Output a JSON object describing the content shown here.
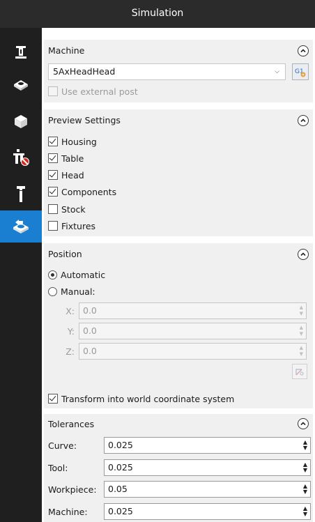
{
  "window": {
    "title": "Simulation"
  },
  "sidebar": {
    "items": [
      {
        "icon": "machine-column-icon",
        "active": false
      },
      {
        "icon": "stock-box-icon",
        "active": false
      },
      {
        "icon": "cube-icon",
        "active": false
      },
      {
        "icon": "fixture-disabled-icon",
        "active": false
      },
      {
        "icon": "tool-holder-icon",
        "active": false
      },
      {
        "icon": "simulation-table-icon",
        "active": true
      }
    ]
  },
  "machine": {
    "title": "Machine",
    "selected": "5AxHeadHead",
    "post_button": "G1",
    "use_external_post": "Use external post"
  },
  "preview": {
    "title": "Preview Settings",
    "items": [
      {
        "label": "Housing",
        "checked": true
      },
      {
        "label": "Table",
        "checked": true
      },
      {
        "label": "Head",
        "checked": true
      },
      {
        "label": "Components",
        "checked": true
      },
      {
        "label": "Stock",
        "checked": false
      },
      {
        "label": "Fixtures",
        "checked": false
      }
    ]
  },
  "position": {
    "title": "Position",
    "automatic": "Automatic",
    "manual": "Manual:",
    "x_label": "X:",
    "x_value": "0.0",
    "y_label": "Y:",
    "y_value": "0.0",
    "z_label": "Z:",
    "z_value": "0.0",
    "transform": "Transform into world coordinate system"
  },
  "tolerances": {
    "title": "Tolerances",
    "curve_label": "Curve:",
    "curve_value": "0.025",
    "tool_label": "Tool:",
    "tool_value": "0.025",
    "workpiece_label": "Workpiece:",
    "workpiece_value": "0.05",
    "machine_label": "Machine:",
    "machine_value": "0.025"
  },
  "colors": {
    "accent": "#1a7fd0",
    "sidebar": "#1f1f1f",
    "titlebar": "#2b2b2b",
    "section": "#f0f0f0"
  }
}
